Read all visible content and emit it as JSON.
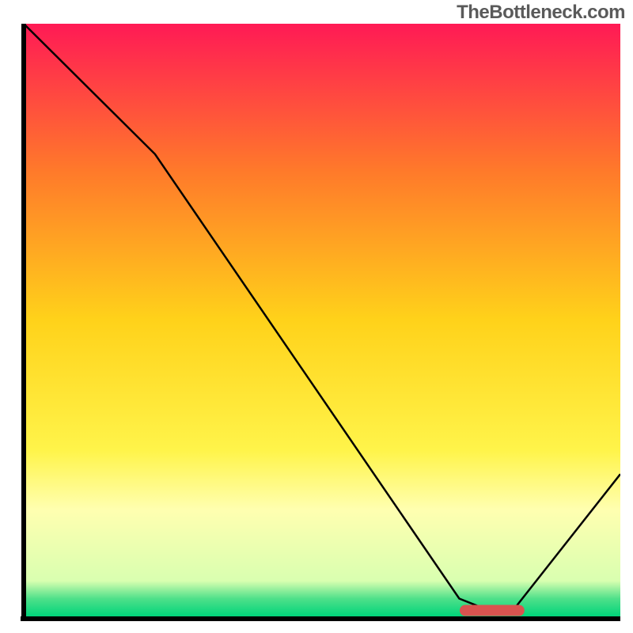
{
  "watermark": "TheBottleneck.com",
  "chart_data": {
    "type": "line",
    "title": "",
    "xlabel": "",
    "ylabel": "",
    "xlim": [
      0,
      100
    ],
    "ylim": [
      0,
      100
    ],
    "grid": false,
    "series": [
      {
        "name": "bottleneck_curve",
        "x": [
          0,
          22,
          73,
          78,
          82,
          100
        ],
        "y": [
          100,
          78,
          3,
          1,
          1,
          24
        ]
      }
    ],
    "marker_range_x": [
      74,
      83
    ],
    "background_gradient": {
      "stops": [
        {
          "offset": 0.0,
          "color": "#ff1a55"
        },
        {
          "offset": 0.25,
          "color": "#ff7a2a"
        },
        {
          "offset": 0.5,
          "color": "#ffd21a"
        },
        {
          "offset": 0.72,
          "color": "#fff44a"
        },
        {
          "offset": 0.82,
          "color": "#ffffb0"
        },
        {
          "offset": 0.94,
          "color": "#d9ffb0"
        },
        {
          "offset": 0.97,
          "color": "#4fe08a"
        },
        {
          "offset": 1.0,
          "color": "#00d47a"
        }
      ]
    }
  }
}
